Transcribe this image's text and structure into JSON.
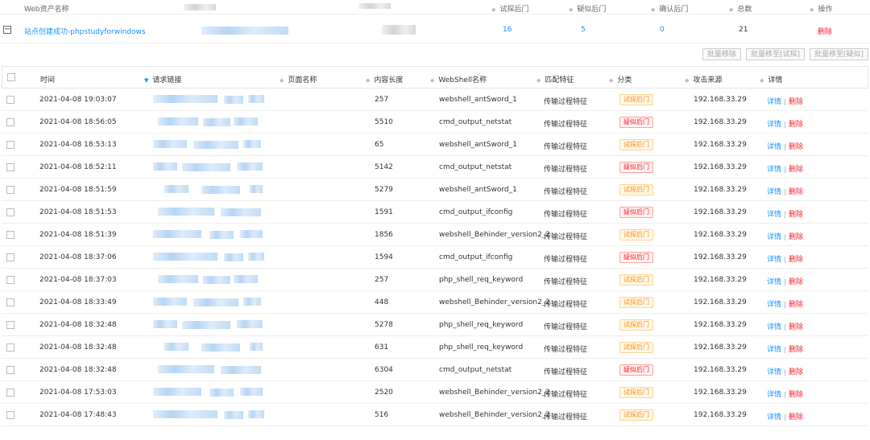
{
  "asset_table": {
    "columns": {
      "name": "Web资产名称",
      "test": "试探后门",
      "suspect": "疑似后门",
      "confirm": "确认后门",
      "total": "总数",
      "ops": "操作"
    },
    "row": {
      "name": "站点创建成功-phpstudyforwindows",
      "test": "16",
      "suspect": "5",
      "confirm": "0",
      "total": "21",
      "delete": "删除"
    }
  },
  "batch": {
    "remove": "批量移除",
    "move_test": "批量移至[试探]",
    "move_suspect": "批量移至[疑似]"
  },
  "events_table": {
    "columns": {
      "time": "时间",
      "request": "请求链接",
      "page_name": "页面名称",
      "length": "内容长度",
      "webshell": "WebShell名称",
      "feature": "匹配特征",
      "category": "分类",
      "source": "攻击来源",
      "detail": "详情"
    },
    "detail_label": "详情",
    "delete_label": "删除",
    "rows": [
      {
        "time": "2021-04-08 19:03:07",
        "length": "257",
        "webshell": "webshell_antSword_1",
        "feature": "传输过程特征",
        "category": "试探后门",
        "category_color": "yellow",
        "source": "192.168.33.29"
      },
      {
        "time": "2021-04-08 18:56:05",
        "length": "5510",
        "webshell": "cmd_output_netstat",
        "feature": "传输过程特征",
        "category": "疑似后门",
        "category_color": "red",
        "source": "192.168.33.29"
      },
      {
        "time": "2021-04-08 18:53:13",
        "length": "65",
        "webshell": "webshell_antSword_1",
        "feature": "传输过程特征",
        "category": "试探后门",
        "category_color": "yellow",
        "source": "192.168.33.29"
      },
      {
        "time": "2021-04-08 18:52:11",
        "length": "5142",
        "webshell": "cmd_output_netstat",
        "feature": "传输过程特征",
        "category": "疑似后门",
        "category_color": "red",
        "source": "192.168.33.29"
      },
      {
        "time": "2021-04-08 18:51:59",
        "length": "5279",
        "webshell": "webshell_antSword_1",
        "feature": "传输过程特征",
        "category": "试探后门",
        "category_color": "yellow",
        "source": "192.168.33.29"
      },
      {
        "time": "2021-04-08 18:51:53",
        "length": "1591",
        "webshell": "cmd_output_ifconfig",
        "feature": "传输过程特征",
        "category": "疑似后门",
        "category_color": "red",
        "source": "192.168.33.29"
      },
      {
        "time": "2021-04-08 18:51:39",
        "length": "1856",
        "webshell": "webshell_Behinder_version2_2",
        "feature": "传输过程特征",
        "category": "试探后门",
        "category_color": "yellow",
        "source": "192.168.33.29"
      },
      {
        "time": "2021-04-08 18:37:06",
        "length": "1594",
        "webshell": "cmd_output_ifconfig",
        "feature": "传输过程特征",
        "category": "疑似后门",
        "category_color": "red",
        "source": "192.168.33.29"
      },
      {
        "time": "2021-04-08 18:37:03",
        "length": "257",
        "webshell": "php_shell_req_keyword",
        "feature": "传输过程特征",
        "category": "试探后门",
        "category_color": "yellow",
        "source": "192.168.33.29"
      },
      {
        "time": "2021-04-08 18:33:49",
        "length": "448",
        "webshell": "webshell_Behinder_version2_2",
        "feature": "传输过程特征",
        "category": "试探后门",
        "category_color": "yellow",
        "source": "192.168.33.29"
      },
      {
        "time": "2021-04-08 18:32:48",
        "length": "5278",
        "webshell": "php_shell_req_keyword",
        "feature": "传输过程特征",
        "category": "试探后门",
        "category_color": "yellow",
        "source": "192.168.33.29"
      },
      {
        "time": "2021-04-08 18:32:48",
        "length": "631",
        "webshell": "php_shell_req_keyword",
        "feature": "传输过程特征",
        "category": "试探后门",
        "category_color": "yellow",
        "source": "192.168.33.29"
      },
      {
        "time": "2021-04-08 18:32:48",
        "length": "6304",
        "webshell": "cmd_output_netstat",
        "feature": "传输过程特征",
        "category": "疑似后门",
        "category_color": "red",
        "source": "192.168.33.29"
      },
      {
        "time": "2021-04-08 17:53:03",
        "length": "2520",
        "webshell": "webshell_Behinder_version2_2",
        "feature": "传输过程特征",
        "category": "试探后门",
        "category_color": "yellow",
        "source": "192.168.33.29"
      },
      {
        "time": "2021-04-08 17:48:43",
        "length": "516",
        "webshell": "webshell_Behinder_version2_2",
        "feature": "传输过程特征",
        "category": "试探后门",
        "category_color": "yellow",
        "source": "192.168.33.29"
      }
    ]
  }
}
